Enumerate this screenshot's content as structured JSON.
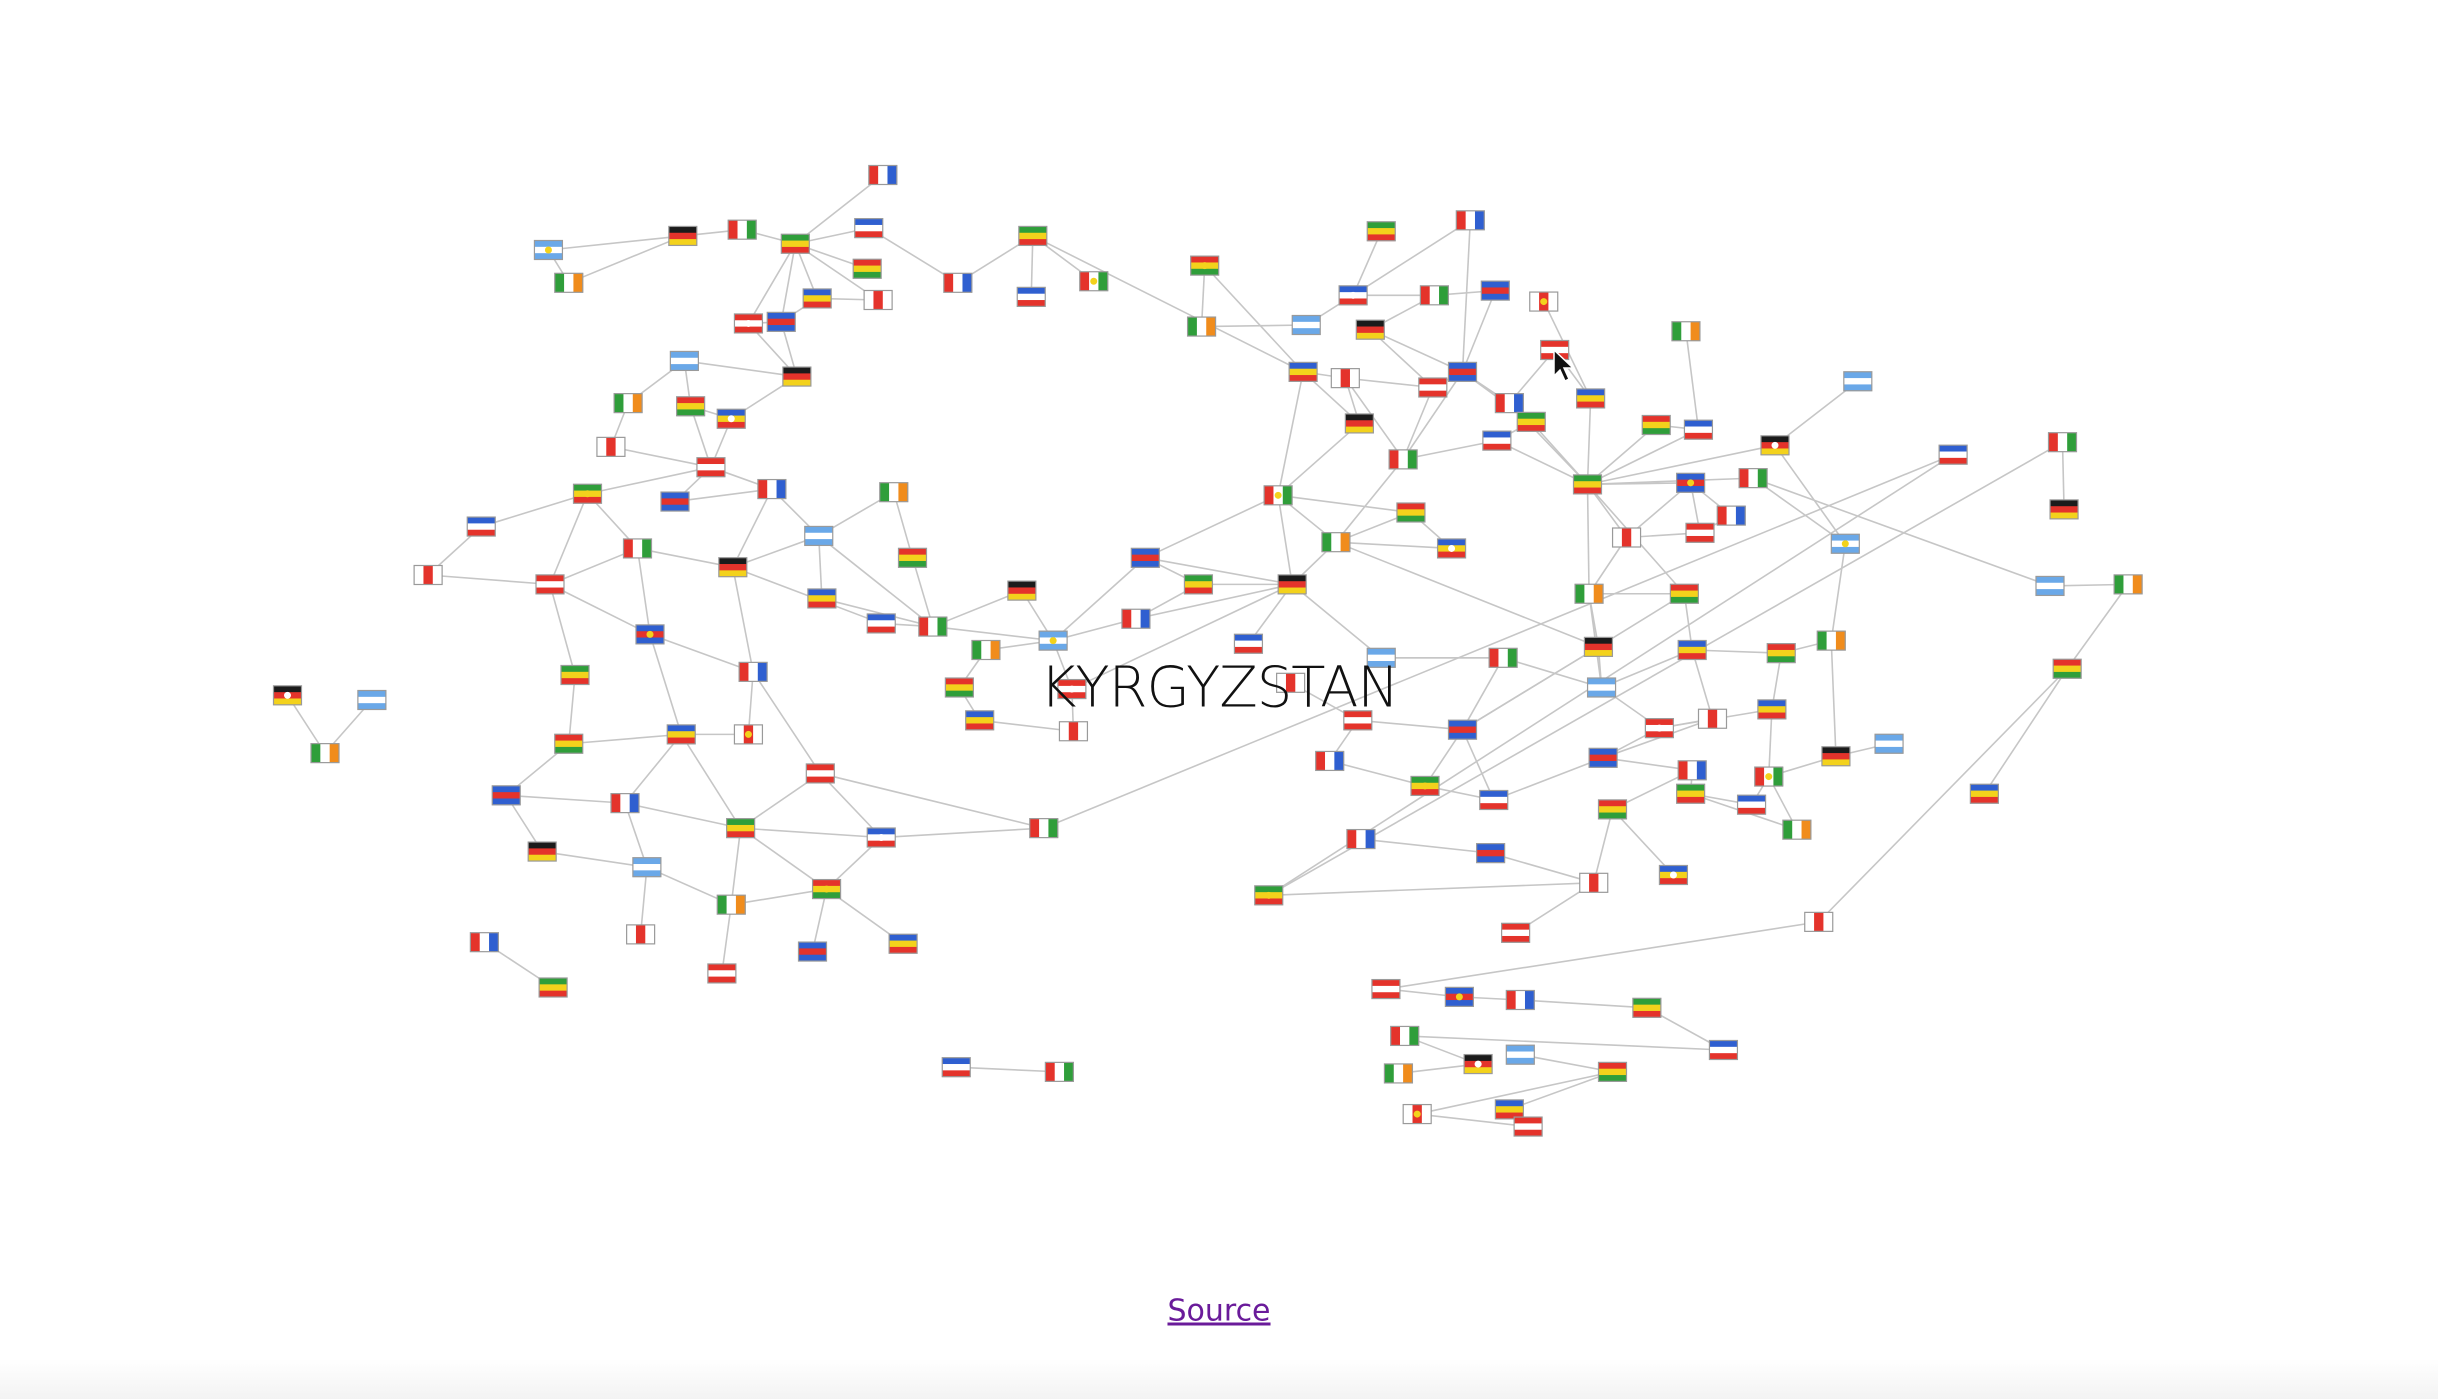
{
  "hover_label": "KYRGYZSTAN",
  "source_link": "Source",
  "colors": {
    "edge": "#c6c6c6",
    "flag_border": "#9a9a9a",
    "label": "#111111",
    "link": "#6a1b9a"
  },
  "flag_palette": {
    "red": "#e4332b",
    "green": "#2f9e3a",
    "blue": "#2f5fd0",
    "lightblue": "#6aa8e8",
    "yellow": "#f3d21c",
    "orange": "#f08c1c",
    "white": "#ffffff",
    "black": "#1b1b1b",
    "darkred": "#8c1b2b"
  }
}
